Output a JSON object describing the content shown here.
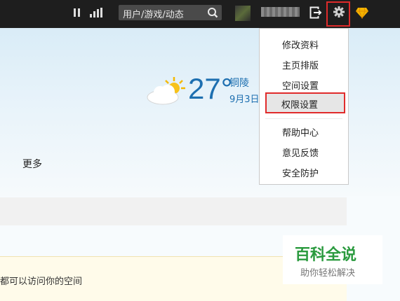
{
  "topbar": {
    "search_placeholder": "用户/游戏/动态",
    "icons": [
      "pause-icon",
      "signal-bars-icon",
      "search-icon",
      "logout-icon",
      "gear-icon",
      "diamond-icon"
    ]
  },
  "weather": {
    "temperature": "27°",
    "city": "铜陵",
    "date": "9月3日"
  },
  "main": {
    "more_label": "更多",
    "notice_text": "都可以访问你的空间"
  },
  "settings_menu": {
    "items": [
      "修改资料",
      "主页排版",
      "空间设置",
      "权限设置",
      "帮助中心",
      "意见反馈",
      "安全防护"
    ],
    "highlighted": "权限设置"
  },
  "watermark": {
    "title": "百科全说",
    "subtitle": "助你轻松解决"
  },
  "colors": {
    "topbar": "#1e1e1e",
    "accent_red": "#e02b2b",
    "weather_blue": "#1d6fb0",
    "watermark_green": "#2a9a3e"
  }
}
